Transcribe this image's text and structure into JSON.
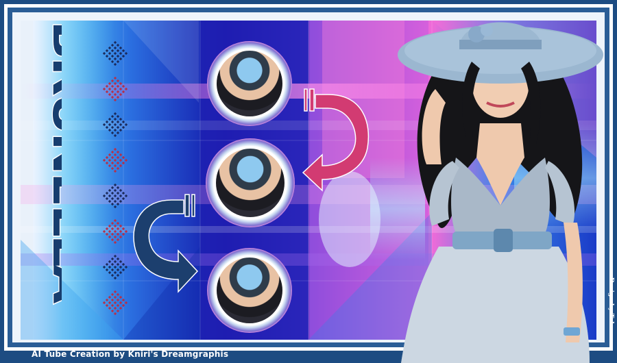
{
  "footer": {
    "creation_credit": "AI Tube Creation by Kniri's Dreamgraphis"
  },
  "side_credit": {
    "text": "Design by Tala"
  },
  "title": {
    "text": "BRUNELLA"
  },
  "icons": {
    "arrow_top": "curved-arrow-pink",
    "arrow_bottom": "curved-arrow-navy",
    "diamond_pattern": "diamond-dots"
  },
  "colors": {
    "frame_navy": "#1d4c82",
    "arrow_pink": "#d6336c",
    "arrow_navy": "#1c3f6e",
    "title_navy": "#173d6e"
  }
}
